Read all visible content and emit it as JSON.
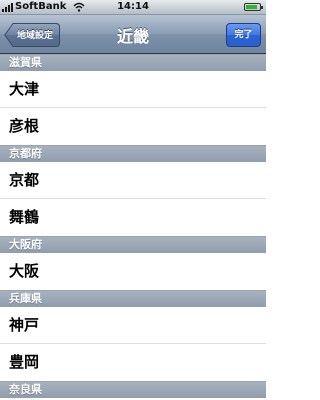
{
  "status_bar": {
    "carrier": "SoftBank",
    "time": "14:14",
    "battery_level": 0.85,
    "icons": [
      "signal-icon",
      "wifi-icon",
      "battery-icon"
    ]
  },
  "nav": {
    "title": "近畿",
    "back_label": "地域設定",
    "done_label": "完了"
  },
  "sections": [
    {
      "header": "滋賀県",
      "items": [
        "大津",
        "彦根"
      ]
    },
    {
      "header": "京都府",
      "items": [
        "京都",
        "舞鶴"
      ]
    },
    {
      "header": "大阪府",
      "items": [
        "大阪"
      ]
    },
    {
      "header": "兵庫県",
      "items": [
        "神戸",
        "豊岡"
      ]
    },
    {
      "header": "奈良県",
      "items": []
    }
  ],
  "colors": {
    "nav_bar": "#8a9db4",
    "done_button": "#2c5fc8",
    "section_header": "#9aa6b4"
  }
}
